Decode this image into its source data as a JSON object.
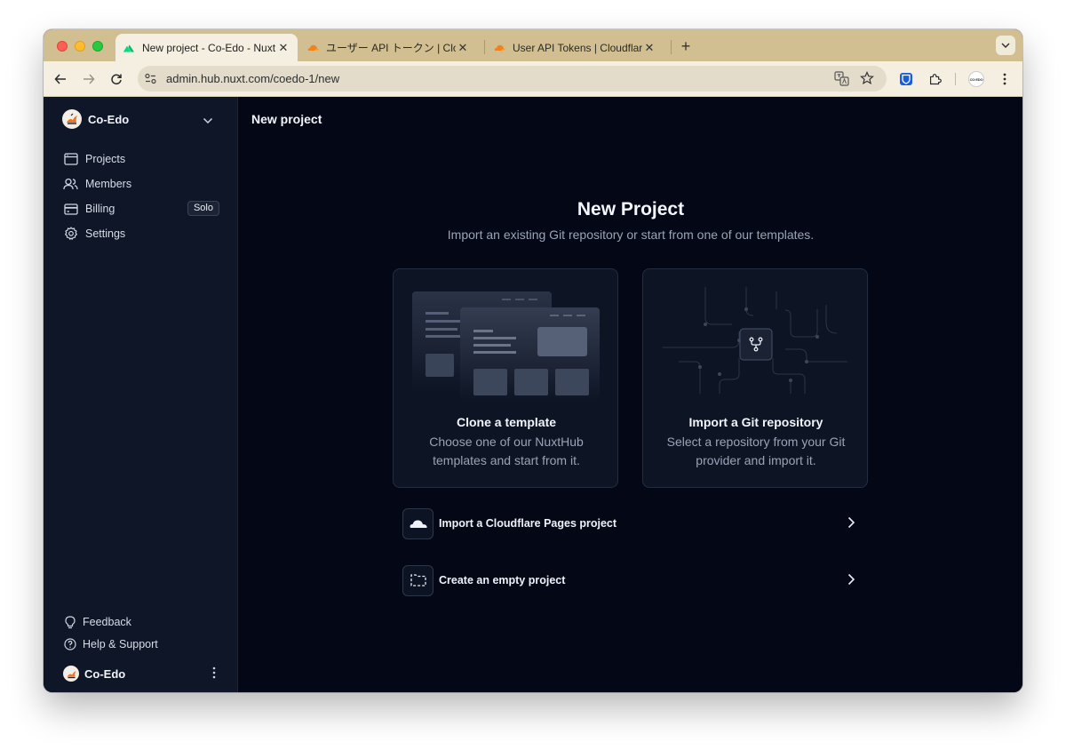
{
  "browser": {
    "tabs": [
      {
        "title": "New project - Co-Edo - NuxtHub",
        "active": true,
        "favicon": "nuxt-icon"
      },
      {
        "title": "ユーザー API トークン | Cloudflare",
        "active": false,
        "favicon": "cloudflare-icon"
      },
      {
        "title": "User API Tokens | Cloudflare",
        "active": false,
        "favicon": "cloudflare-icon"
      }
    ],
    "close_glyph": "✕",
    "new_tab_glyph": "+",
    "url": "admin.hub.nuxt.com/coedo-1/new",
    "avatar_text": "CO·EDO"
  },
  "sidebar": {
    "org_name": "Co-Edo",
    "items": [
      {
        "label": "Projects",
        "icon": "browser-window-icon"
      },
      {
        "label": "Members",
        "icon": "users-icon"
      },
      {
        "label": "Billing",
        "icon": "credit-card-icon",
        "badge": "Solo"
      },
      {
        "label": "Settings",
        "icon": "gear-icon"
      }
    ],
    "bottom_items": [
      {
        "label": "Feedback",
        "icon": "lightbulb-icon"
      },
      {
        "label": "Help & Support",
        "icon": "question-circle-icon"
      }
    ],
    "user_name": "Co-Edo"
  },
  "main": {
    "page_title": "New project",
    "heading": "New Project",
    "subheading": "Import an existing Git repository or start from one of our templates.",
    "cards": [
      {
        "title": "Clone a template",
        "description": "Choose one of our NuxtHub templates and start from it."
      },
      {
        "title": "Import a Git repository",
        "description": "Select a repository from your Git provider and import it."
      }
    ],
    "rows": [
      {
        "label": "Import a Cloudflare Pages project",
        "icon": "cloud-icon"
      },
      {
        "label": "Create an empty project",
        "icon": "dashed-folder-icon"
      }
    ]
  },
  "colors": {
    "tab_strip": "#d1bf91",
    "toolbar": "#f4efe1",
    "sidebar": "#0e1628",
    "main_bg": "#040816",
    "accent_orange": "#e8762d"
  }
}
